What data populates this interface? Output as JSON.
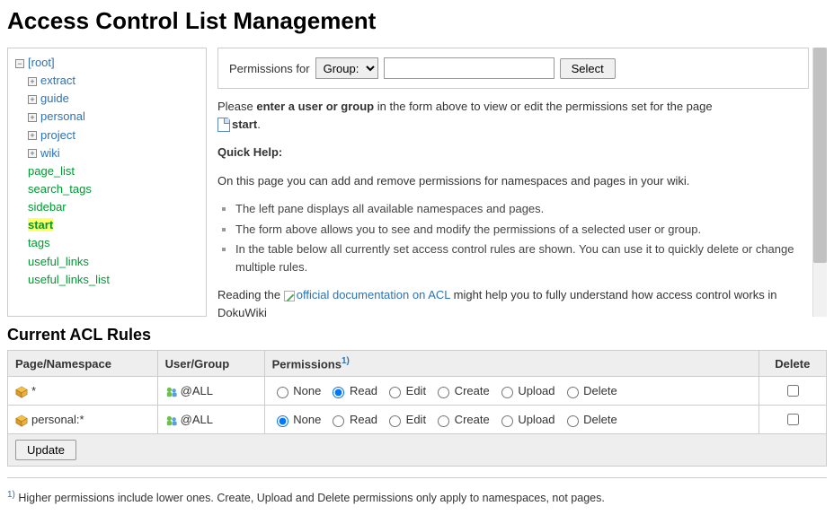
{
  "page_title": "Access Control List Management",
  "tree": {
    "root_label": "[root]",
    "namespaces": [
      {
        "label": "extract"
      },
      {
        "label": "guide"
      },
      {
        "label": "personal"
      },
      {
        "label": "project"
      },
      {
        "label": "wiki"
      }
    ],
    "pages": [
      {
        "label": "page_list",
        "selected": false
      },
      {
        "label": "search_tags",
        "selected": false
      },
      {
        "label": "sidebar",
        "selected": false
      },
      {
        "label": "start",
        "selected": true
      },
      {
        "label": "tags",
        "selected": false
      },
      {
        "label": "useful_links",
        "selected": false
      },
      {
        "label": "useful_links_list",
        "selected": false
      }
    ]
  },
  "perm_form": {
    "label": "Permissions for",
    "select_options": [
      "Group:"
    ],
    "selected": "Group:",
    "input_value": "",
    "button": "Select"
  },
  "message": {
    "prefix": "Please ",
    "bold1": "enter a user or group",
    "middle": " in the form above to view or edit the permissions set for the page ",
    "page_name": "start",
    "suffix": "."
  },
  "quickhelp": {
    "heading": "Quick Help:",
    "intro": "On this page you can add and remove permissions for namespaces and pages in your wiki.",
    "bullets": [
      "The left pane displays all available namespaces and pages.",
      "The form above allows you to see and modify the permissions of a selected user or group.",
      "In the table below all currently set access control rules are shown. You can use it to quickly delete or change multiple rules."
    ],
    "reading_prefix": "Reading the ",
    "reading_link": "official documentation on ACL",
    "reading_suffix": " might help you to fully understand how access control works in DokuWiki"
  },
  "rules_heading": "Current ACL Rules",
  "table": {
    "headers": {
      "page": "Page/Namespace",
      "user": "User/Group",
      "perm": "Permissions",
      "perm_sup": "1)",
      "delete": "Delete"
    },
    "perm_options": [
      "None",
      "Read",
      "Edit",
      "Create",
      "Upload",
      "Delete"
    ],
    "rows": [
      {
        "page": "*",
        "user": "@ALL",
        "selected": "Read",
        "delete_checked": false
      },
      {
        "page": "personal:*",
        "user": "@ALL",
        "selected": "None",
        "delete_checked": false
      }
    ],
    "update_button": "Update"
  },
  "footnote": {
    "sup": "1)",
    "text": " Higher permissions include lower ones. Create, Upload and Delete permissions only apply to namespaces, not pages."
  }
}
